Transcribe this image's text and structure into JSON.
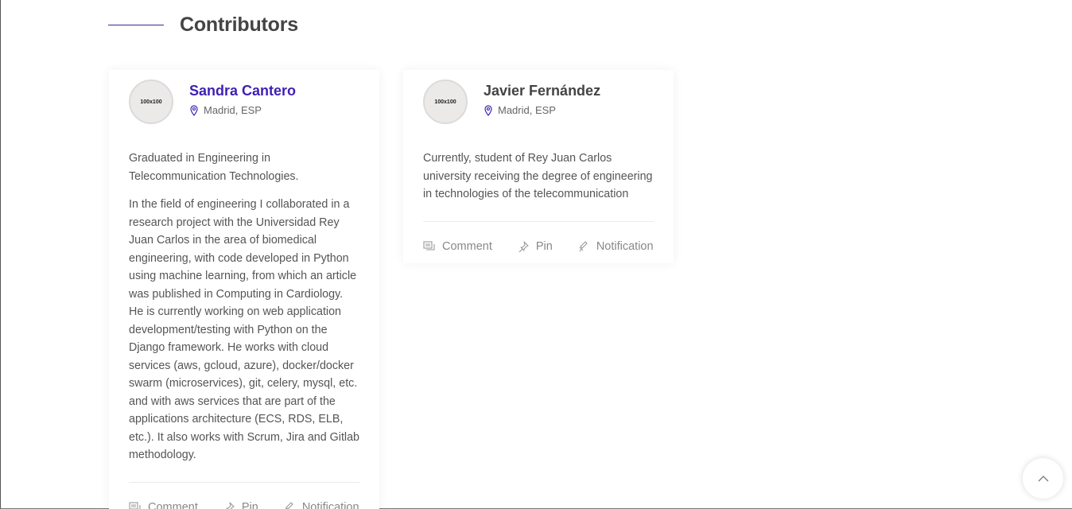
{
  "section": {
    "title": "Contributors"
  },
  "contributors": [
    {
      "avatar_text": "100x100",
      "name": "Sandra Cantero",
      "location": "Madrid, ESP",
      "bio": [
        "Graduated in Engineering in Telecommunication Technologies.",
        "In the field of engineering I collaborated in a research project with the Universidad Rey Juan Carlos in the area of biomedical engineering, with code developed in Python using machine learning, from which an article was published in Computing in Cardiology. He is currently working on web application development/testing with Python on the Django framework. He works with cloud services (aws, gcloud, azure), docker/docker swarm (microservices), git, celery, mysql, etc. and with aws services that are part of the applications architecture (ECS, RDS, ELB, etc.). It also works with Scrum, Jira and Gitlab methodology."
      ],
      "actions": {
        "comment": "Comment",
        "pin": "Pin",
        "notification": "Notification"
      }
    },
    {
      "avatar_text": "100x100",
      "name": "Javier Fernández",
      "location": "Madrid, ESP",
      "bio": [
        "Currently, student of Rey Juan Carlos university receiving the degree of engineering in technologies of the telecommunication"
      ],
      "actions": {
        "comment": "Comment",
        "pin": "Pin",
        "notification": "Notification"
      }
    }
  ],
  "icons": {
    "location": "map-pin-icon",
    "comment": "comment-icon",
    "pin": "pushpin-icon",
    "notification": "bell-icon",
    "scroll_top": "chevron-up-icon"
  },
  "colors": {
    "accent": "#3f1fb3",
    "heading_line": "#3b2a8c"
  }
}
